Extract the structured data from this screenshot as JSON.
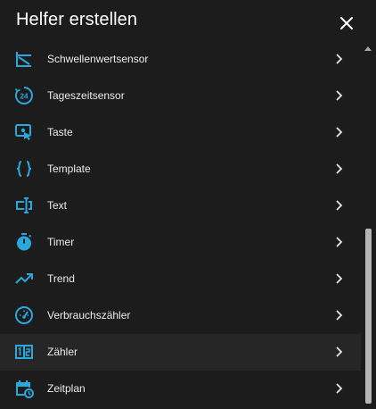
{
  "dialog": {
    "title": "Helfer erstellen"
  },
  "colors": {
    "icon_accent": "#2aa7dc",
    "background": "#1c1c1c",
    "hover_row": "#262626"
  },
  "items": [
    {
      "label": "Schwellenwertsensor",
      "icon": "threshold-sensor-icon"
    },
    {
      "label": "Tageszeitsensor",
      "icon": "time-of-day-24-icon"
    },
    {
      "label": "Taste",
      "icon": "button-press-icon"
    },
    {
      "label": "Template",
      "icon": "curly-braces-icon"
    },
    {
      "label": "Text",
      "icon": "text-field-icon"
    },
    {
      "label": "Timer",
      "icon": "stopwatch-icon"
    },
    {
      "label": "Trend",
      "icon": "trending-up-icon"
    },
    {
      "label": "Verbrauchszähler",
      "icon": "gauge-meter-icon"
    },
    {
      "label": "Zähler",
      "icon": "counter-icon"
    },
    {
      "label": "Zeitplan",
      "icon": "calendar-clock-icon"
    }
  ]
}
